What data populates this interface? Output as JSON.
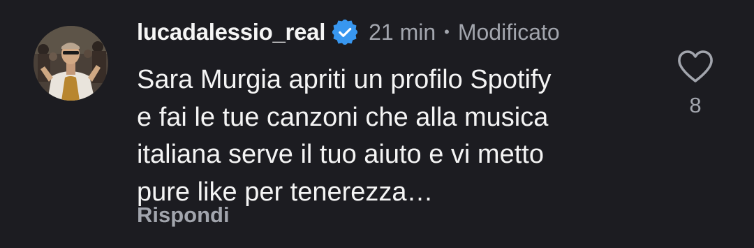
{
  "comment": {
    "username": "lucadalessio_real",
    "verified_icon": "verified-badge-icon",
    "time": "21 min",
    "separator": "•",
    "edited_label": "Modificato",
    "text_lines": [
      "Sara Murgia apriti un profilo Spotify",
      "e fai le tue canzoni che alla musica",
      "italiana serve il tuo aiuto e vi metto",
      "pure like per tenerezza…"
    ],
    "reply_label": "Rispondi",
    "like_icon": "heart-icon",
    "like_count": "8"
  },
  "colors": {
    "background": "#1c1c21",
    "primary_text": "#f4f4f4",
    "secondary_text": "#a2a5ad",
    "verified_blue": "#3897f0"
  }
}
